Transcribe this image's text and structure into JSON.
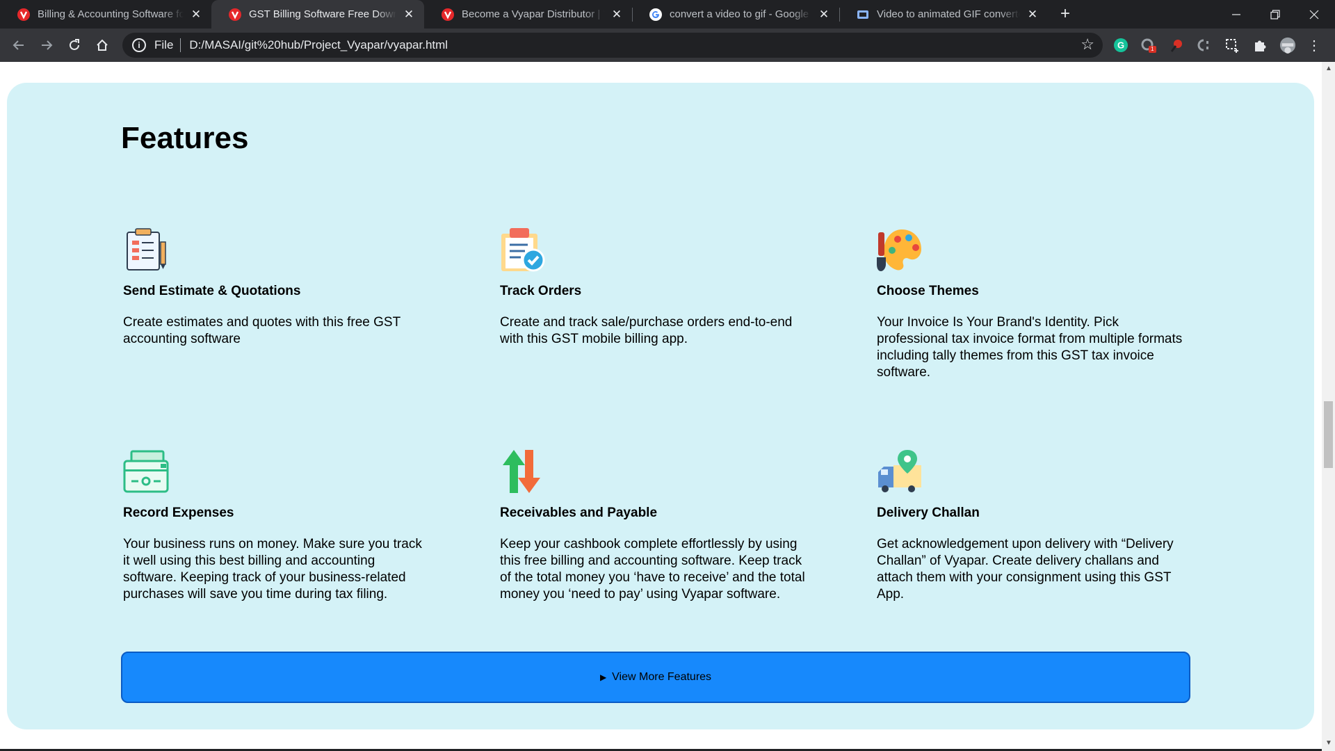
{
  "browser": {
    "tabs": [
      {
        "title": "Billing & Accounting Software for Small Business",
        "active": false
      },
      {
        "title": "GST Billing Software Free Download",
        "active": true
      },
      {
        "title": "Become a Vyapar Distributor | Vyapar",
        "active": false
      },
      {
        "title": "convert a video to gif - Google Search",
        "active": false
      },
      {
        "title": "Video to animated GIF converter",
        "active": false
      }
    ],
    "address": {
      "scheme_label": "File",
      "url": "D:/MASAI/git%20hub/Project_Vyapar/vyapar.html"
    },
    "extension_badge": "1"
  },
  "features": {
    "heading": "Features",
    "items": [
      {
        "icon": "estimate-document-icon",
        "title": "Send Estimate & Quotations",
        "text": "Create estimates and quotes with this free GST accounting software"
      },
      {
        "icon": "checklist-clipboard-icon",
        "title": "Track Orders",
        "text": "Create and track sale/purchase orders end-to-end with this GST mobile billing app."
      },
      {
        "icon": "paint-palette-icon",
        "title": "Choose Themes",
        "text": "Your Invoice Is Your Brand's Identity. Pick professional tax invoice format from multiple formats including tally themes from this GST tax invoice software."
      },
      {
        "icon": "wallet-icon",
        "title": "Record Expenses",
        "text": "Your business runs on money. Make sure you track it well using this best billing and accounting software. Keeping track of your business-related purchases will save you time during tax filing."
      },
      {
        "icon": "up-down-arrows-icon",
        "title": "Receivables and Payable",
        "text": "Keep your cashbook complete effortlessly by using this free billing and accounting software. Keep track of the total money you ‘have to receive’ and the total money you ‘need to pay’ using Vyapar software."
      },
      {
        "icon": "delivery-truck-icon",
        "title": "Delivery Challan",
        "text": "Get acknowledgement upon delivery with “Delivery Challan” of Vyapar. Create delivery challans and attach them with your consignment using this GST App."
      }
    ],
    "more_label": "View More Features"
  },
  "colors": {
    "section_bg": "#d4f2f7",
    "button_bg": "#1789fc",
    "chrome_dark": "#202124",
    "chrome_mid": "#35363a"
  }
}
